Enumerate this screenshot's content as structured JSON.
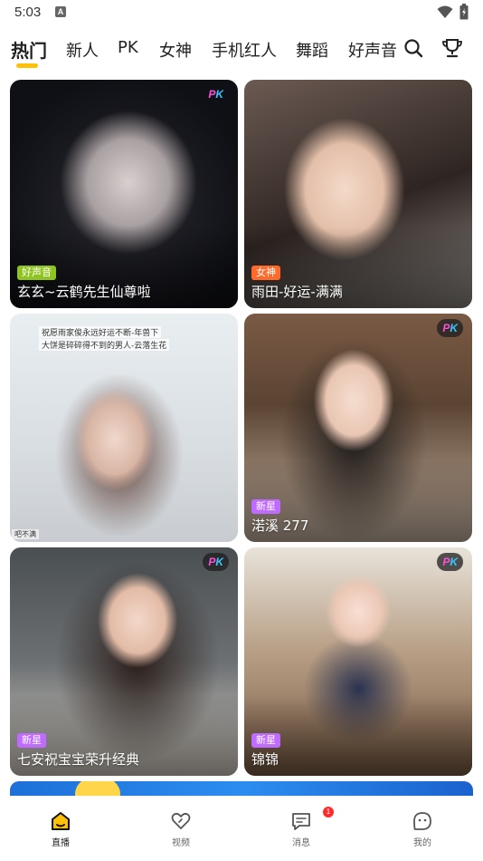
{
  "status_bar": {
    "time": "5:03",
    "notification_letter": "A"
  },
  "tabs": [
    {
      "label": "热门",
      "active": true
    },
    {
      "label": "新人"
    },
    {
      "label": "PK"
    },
    {
      "label": "女神"
    },
    {
      "label": "手机红人"
    },
    {
      "label": "舞蹈"
    },
    {
      "label": "好声音"
    }
  ],
  "header_icons": {
    "search": "search-icon",
    "ranking": "trophy-icon"
  },
  "cards": [
    {
      "title": "玄玄~云鹤先生仙尊啦",
      "tag": "好声音",
      "tag_color": "#8fc31f",
      "pk": true,
      "pk_style": "plain",
      "pk_p": "P",
      "pk_k": "K"
    },
    {
      "title": "雨田-好运-满满",
      "tag": "女神",
      "tag_color": "#ff6a2b",
      "pk": false
    },
    {
      "title": "",
      "tag": "",
      "pk": false,
      "overlay_line1": "祝愿雨家俊永远好运不断-年兽下",
      "overlay_line2": "大饼是碎碎得不到的男人-云落生花",
      "corner_text": "吧不满"
    },
    {
      "title": "渃溪 277",
      "tag": "新星",
      "tag_color": "#c06bff",
      "pk": true,
      "pk_style": "dark",
      "pk_p": "P",
      "pk_k": "K"
    },
    {
      "title": "七安祝宝宝荣升经典",
      "tag": "新星",
      "tag_color": "#c06bff",
      "pk": true,
      "pk_style": "dark",
      "pk_p": "P",
      "pk_k": "K"
    },
    {
      "title": "锦锦",
      "tag": "新星",
      "tag_color": "#c06bff",
      "pk": true,
      "pk_style": "dark",
      "pk_p": "P",
      "pk_k": "K"
    }
  ],
  "bottom_nav": [
    {
      "label": "直播",
      "icon": "home-icon",
      "active": true
    },
    {
      "label": "视频",
      "icon": "heart-icon"
    },
    {
      "label": "消息",
      "icon": "message-icon",
      "badge": "1"
    },
    {
      "label": "我的",
      "icon": "profile-icon"
    }
  ],
  "colors": {
    "accent": "#ffc107",
    "badge_red": "#ff2a2a"
  }
}
